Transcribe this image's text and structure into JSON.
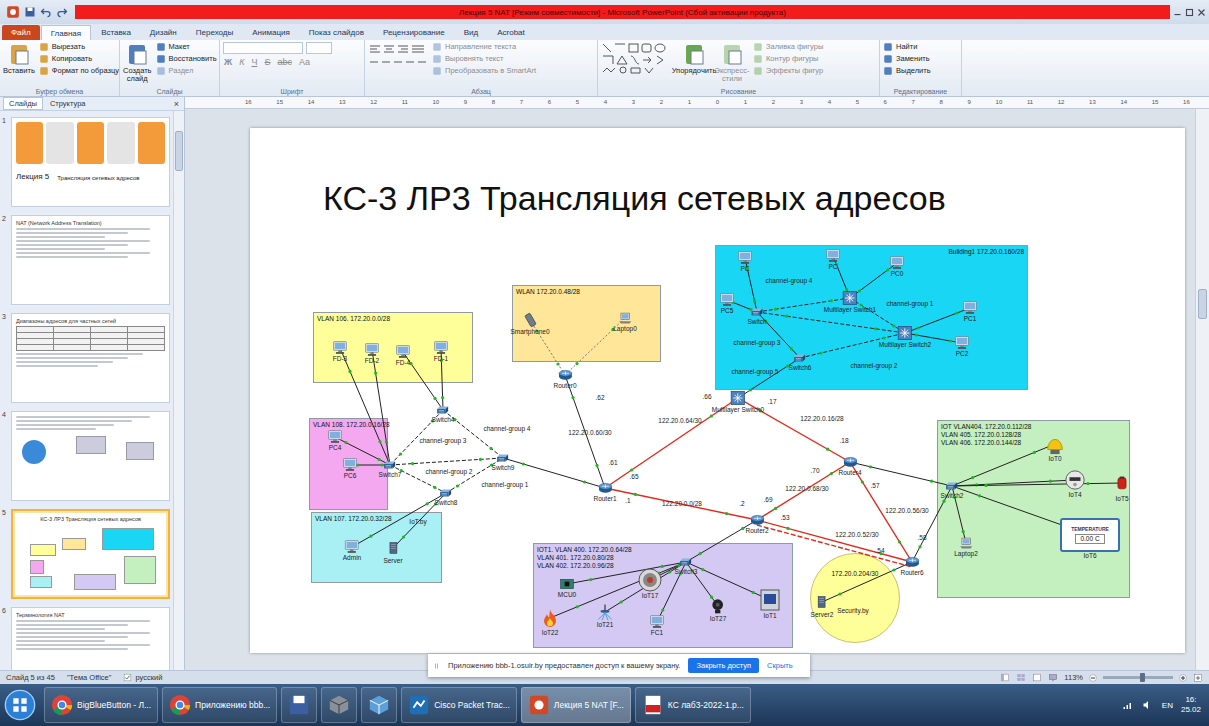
{
  "window": {
    "title": "Лекция 5 NAT [Режим совместимости] - Microsoft PowerPoint (Сбой активации продукта)"
  },
  "ribbon_tabs": [
    {
      "label": "Файл",
      "selected": false
    },
    {
      "label": "Главная",
      "selected": true
    },
    {
      "label": "Вставка",
      "selected": false
    },
    {
      "label": "Дизайн",
      "selected": false
    },
    {
      "label": "Переходы",
      "selected": false
    },
    {
      "label": "Анимация",
      "selected": false
    },
    {
      "label": "Показ слайдов",
      "selected": false
    },
    {
      "label": "Рецензирование",
      "selected": false
    },
    {
      "label": "Вид",
      "selected": false
    },
    {
      "label": "Acrobat",
      "selected": false
    }
  ],
  "ribbon_groups": [
    {
      "label": "Буфер обмена",
      "items": [
        {
          "label": "Вставить",
          "kind": "big",
          "disabled": false
        },
        {
          "label": "Вырезать",
          "kind": "small",
          "disabled": false
        },
        {
          "label": "Копировать",
          "kind": "small",
          "disabled": false
        },
        {
          "label": "Формат по образцу",
          "kind": "small",
          "disabled": false
        }
      ]
    },
    {
      "label": "Слайды",
      "items": [
        {
          "label": "Создать слайд",
          "kind": "big",
          "disabled": false
        },
        {
          "label": "Макет",
          "kind": "small",
          "disabled": false
        },
        {
          "label": "Восстановить",
          "kind": "small",
          "disabled": false
        },
        {
          "label": "Раздел",
          "kind": "small",
          "disabled": true
        }
      ]
    },
    {
      "label": "Шрифт",
      "items": [
        {
          "label": "Ж",
          "kind": "glyph",
          "disabled": true
        },
        {
          "label": "К",
          "kind": "glyph",
          "disabled": true
        },
        {
          "label": "Ч",
          "kind": "glyph",
          "disabled": true
        },
        {
          "label": "S",
          "kind": "glyph",
          "disabled": true
        },
        {
          "label": "abc",
          "kind": "glyph",
          "disabled": true
        },
        {
          "label": "Аа",
          "kind": "glyph",
          "disabled": true
        }
      ]
    },
    {
      "label": "Абзац",
      "items": [
        {
          "label": "Направление текста",
          "kind": "small",
          "disabled": true
        },
        {
          "label": "Выровнять текст",
          "kind": "small",
          "disabled": true
        },
        {
          "label": "Преобразовать в SmartArt",
          "kind": "small",
          "disabled": true
        }
      ]
    },
    {
      "label": "Рисование",
      "items": [
        {
          "label": "Упорядочить",
          "kind": "big",
          "disabled": false
        },
        {
          "label": "Экспресс-стили",
          "kind": "big",
          "disabled": true
        },
        {
          "label": "Заливка фигуры",
          "kind": "small",
          "disabled": true
        },
        {
          "label": "Контур фигуры",
          "kind": "small",
          "disabled": true
        },
        {
          "label": "Эффекты фигур",
          "kind": "small",
          "disabled": true
        }
      ]
    },
    {
      "label": "Редактирование",
      "items": [
        {
          "label": "Найти",
          "kind": "small",
          "disabled": false
        },
        {
          "label": "Заменить",
          "kind": "small",
          "disabled": false
        },
        {
          "label": "Выделить",
          "kind": "small",
          "disabled": false
        }
      ]
    }
  ],
  "slides_pane": {
    "tabs": [
      {
        "label": "Слайды",
        "selected": true
      },
      {
        "label": "Структура",
        "selected": false
      }
    ],
    "close": "×",
    "thumbs": [
      {
        "number": "1",
        "kind": "title",
        "selected": false,
        "texts": [
          "Лекция 5",
          "Трансляция сетевых адресов"
        ]
      },
      {
        "number": "2",
        "kind": "bullets",
        "selected": false,
        "texts": [
          "NAT (Network Address Translation)"
        ]
      },
      {
        "number": "3",
        "kind": "table",
        "selected": false,
        "texts": [
          "Диапазоны адресов для частных сетей"
        ]
      },
      {
        "number": "4",
        "kind": "picture",
        "selected": false,
        "texts": []
      },
      {
        "number": "5",
        "kind": "diagram",
        "selected": true,
        "texts": [
          "КС-3 ЛР3 Трансляция сетевых адресов"
        ]
      },
      {
        "number": "6",
        "kind": "bullets",
        "selected": false,
        "texts": [
          "Терминология NAT"
        ]
      }
    ]
  },
  "ruler": [
    "16",
    "15",
    "14",
    "13",
    "12",
    "11",
    "10",
    "9",
    "8",
    "7",
    "6",
    "5",
    "4",
    "3",
    "2",
    "1",
    "0",
    "1",
    "2",
    "3",
    "4",
    "5",
    "6",
    "7",
    "8",
    "9",
    "10",
    "11",
    "12",
    "13",
    "14",
    "15",
    "16"
  ],
  "slide": {
    "title": "КС-3 ЛР3 Трансляция сетевых адресов",
    "zones": [
      {
        "lines": [
          "VLAN 106. 172.20.0.0/28"
        ],
        "color": "#ffff99",
        "kind": "box"
      },
      {
        "lines": [
          "VLAN 108. 172.20.0.16/28"
        ],
        "color": "#f4a8f0",
        "kind": "box"
      },
      {
        "lines": [
          "VLAN 107. 172.20.0.32/28"
        ],
        "color": "#a8f0f4",
        "kind": "box"
      },
      {
        "lines": [
          "WLAN 172.20.0.48/28"
        ],
        "color": "#ffe699",
        "kind": "box"
      },
      {
        "lines": [
          "Building1 172.20.0.160/28"
        ],
        "color": "#19d6f5",
        "kind": "box"
      },
      {
        "lines": [
          "IOT VLAN404. 172.20.0.112/28",
          "VLAN 405. 172.20.0.128/28",
          "VLAN 406. 172.20.0.144/28"
        ],
        "color": "#c4efbf",
        "kind": "box"
      },
      {
        "lines": [
          "IOT1. VLAN 400. 172.20.0.64/28",
          "VLAN 401. 172.20.0.80/28",
          "VLAN 402. 172.20.0.96/28"
        ],
        "color": "#d3c9f2",
        "kind": "box"
      },
      {
        "lines": [
          "172.20.0.204/30"
        ],
        "color": "#ffff99",
        "kind": "circle"
      }
    ],
    "nodes": [
      {
        "label": "FD-3",
        "kind": "pc"
      },
      {
        "label": "FD-2",
        "kind": "pc"
      },
      {
        "label": "FD-4",
        "kind": "pc"
      },
      {
        "label": "FD-1",
        "kind": "pc"
      },
      {
        "label": "PC4",
        "kind": "pc"
      },
      {
        "label": "PC6",
        "kind": "pc"
      },
      {
        "label": "Admin",
        "kind": "pc"
      },
      {
        "label": "Server",
        "kind": "server"
      },
      {
        "label": "Switch4",
        "kind": "switch"
      },
      {
        "label": "Switch7",
        "kind": "switch"
      },
      {
        "label": "Switch9",
        "kind": "switch"
      },
      {
        "label": "Switch8",
        "kind": "switch"
      },
      {
        "label": "Router0",
        "kind": "router"
      },
      {
        "label": "Smartphone0",
        "kind": "phone"
      },
      {
        "label": "Laptop0",
        "kind": "laptop"
      },
      {
        "label": "Router1",
        "kind": "router"
      },
      {
        "label": "Multilayer Switch0",
        "kind": "mlswitch"
      },
      {
        "label": "PC",
        "kind": "pc"
      },
      {
        "label": "PC",
        "kind": "pc"
      },
      {
        "label": "PC0",
        "kind": "pc"
      },
      {
        "label": "PC5",
        "kind": "pc"
      },
      {
        "label": "Switch",
        "kind": "switch"
      },
      {
        "label": "Multilayer Switch1",
        "kind": "mlswitch"
      },
      {
        "label": "Multilayer Switch2",
        "kind": "mlswitch"
      },
      {
        "label": "PC1",
        "kind": "pc"
      },
      {
        "label": "PC2",
        "kind": "pc"
      },
      {
        "label": "Switch6",
        "kind": "switch"
      },
      {
        "label": "Router4",
        "kind": "router"
      },
      {
        "label": "Router2",
        "kind": "router"
      },
      {
        "label": "Router6",
        "kind": "router"
      },
      {
        "label": "Switch2",
        "kind": "switch"
      },
      {
        "label": "IoT0",
        "kind": "lamp"
      },
      {
        "label": "IoT4",
        "kind": "meter"
      },
      {
        "label": "IoT5",
        "kind": "siren"
      },
      {
        "label": "IoT6",
        "kind": "display",
        "texts": [
          "TEMPERATURE",
          "0.00 C"
        ]
      },
      {
        "label": "Laptop2",
        "kind": "laptop"
      },
      {
        "label": "Switch3",
        "kind": "switch"
      },
      {
        "label": "MCU0",
        "kind": "board"
      },
      {
        "label": "IoT22",
        "kind": "fire"
      },
      {
        "label": "IoT21",
        "kind": "sprinkler"
      },
      {
        "label": "IoT17",
        "kind": "fan"
      },
      {
        "label": "FC1",
        "kind": "pc"
      },
      {
        "label": "IoT27",
        "kind": "camera"
      },
      {
        "label": "IoT1",
        "kind": "reader"
      },
      {
        "label": "Server2",
        "kind": "server"
      }
    ],
    "labels": [
      "channel-group 3",
      "channel-group 4",
      "channel-group 2",
      "channel-group 1",
      "IoT.by",
      ".62",
      "122.20.0.60/30",
      ".61",
      ".65",
      "122.20.0.64/30",
      ".66",
      ".17",
      "122.20.0.16/28",
      ".18",
      ".70",
      "122.20.0.68/30",
      ".69",
      ".57",
      "122.20.0.56/30",
      ".58",
      "122.20.0.52/30",
      ".53",
      ".54",
      ".1",
      "122.20.0.0/28",
      ".2",
      "channel-group 4",
      "channel-group 1",
      "channel-group 3",
      "channel-group 2",
      "channel-group 5",
      "Security.by"
    ]
  },
  "notification": {
    "text": "Приложению bbb-1.osuir.by предоставлен доступ к вашему экрану.",
    "primary": "Закрыть доступ",
    "secondary": "Скрыть"
  },
  "status_bar": {
    "slide": "Слайд 5 из 45",
    "theme": "\"Тема Office\"",
    "language": "русский",
    "zoom": "113%",
    "zoom_level": 0.56
  },
  "taskbar": {
    "items": [
      {
        "label": "BigBlueButton - Л...",
        "kind": "chrome",
        "selected": false
      },
      {
        "label": "Приложению bbb...",
        "kind": "chrome",
        "selected": false
      },
      {
        "kind": "save",
        "selected": false
      },
      {
        "kind": "box",
        "selected": false
      },
      {
        "kind": "cube",
        "selected": false
      },
      {
        "label": "Cisco Packet Trac...",
        "kind": "cisco",
        "selected": false
      },
      {
        "label": "Лекция 5 NAT [F...",
        "kind": "ppt",
        "selected": true
      },
      {
        "label": "КС лаб3-2022-1.p...",
        "kind": "pdf",
        "selected": false
      }
    ],
    "tray": {
      "language": "EN",
      "time": "16:",
      "date": "25.02"
    }
  }
}
